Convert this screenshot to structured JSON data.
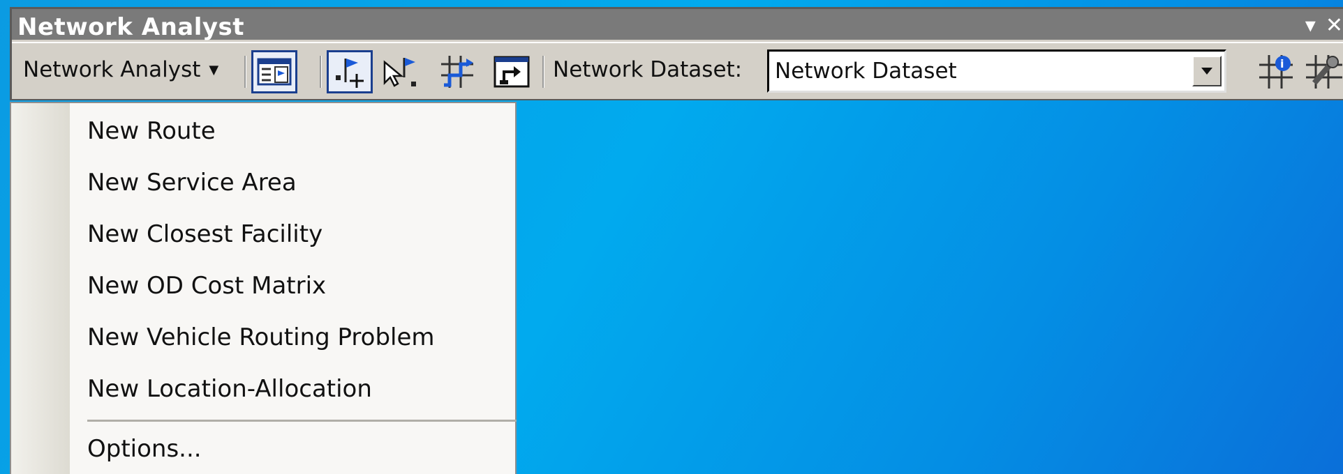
{
  "window": {
    "title": "Network Analyst",
    "minimize_glyph": "▾",
    "close_glyph": "✕"
  },
  "toolbar": {
    "menu_label": "Network Analyst",
    "tools": [
      {
        "name": "network-analyst-window-icon",
        "active": true
      },
      {
        "name": "create-network-location-icon",
        "active": true
      },
      {
        "name": "select-move-location-icon",
        "active": false
      },
      {
        "name": "solve-icon",
        "active": false
      },
      {
        "name": "directions-window-icon",
        "active": false
      },
      {
        "name": "build-network-icon",
        "active": false
      },
      {
        "name": "network-identify-icon",
        "active": false
      }
    ],
    "dataset_label": "Network Dataset:",
    "dataset_value": "Network Dataset"
  },
  "menu": {
    "items": [
      "New Route",
      "New Service Area",
      "New Closest Facility",
      "New OD Cost Matrix",
      "New Vehicle Routing Problem",
      "New Location-Allocation"
    ],
    "options_label": "Options..."
  },
  "colors": {
    "desktop": "#03a6e8",
    "titlebar": "#7a7a7a",
    "toolbar": "#d4d0c8",
    "active_border": "#1a3e8e",
    "menu_bg": "#f8f7f5"
  }
}
